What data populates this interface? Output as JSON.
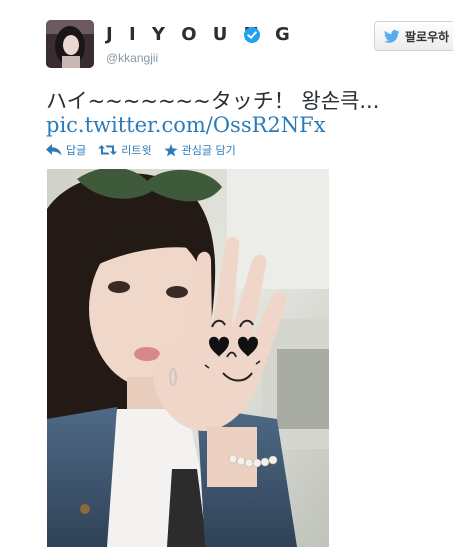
{
  "tweet": {
    "display_name": "J I Y O U N G",
    "handle": "@kkangjii",
    "text": "ハイ~~~~~~~タッチ！ 왕손큭...",
    "link": "pic.twitter.com/OssR2NFx"
  },
  "follow_button": {
    "label": "팔로우하"
  },
  "actions": [
    {
      "label": "답글",
      "icon": "reply-icon"
    },
    {
      "label": "리트윗",
      "icon": "retweet-icon"
    },
    {
      "label": "관심글 담기",
      "icon": "star-icon"
    }
  ],
  "colors": {
    "link": "#2b7bb9",
    "verified": "#1da1f2",
    "muted": "#8899a6"
  }
}
